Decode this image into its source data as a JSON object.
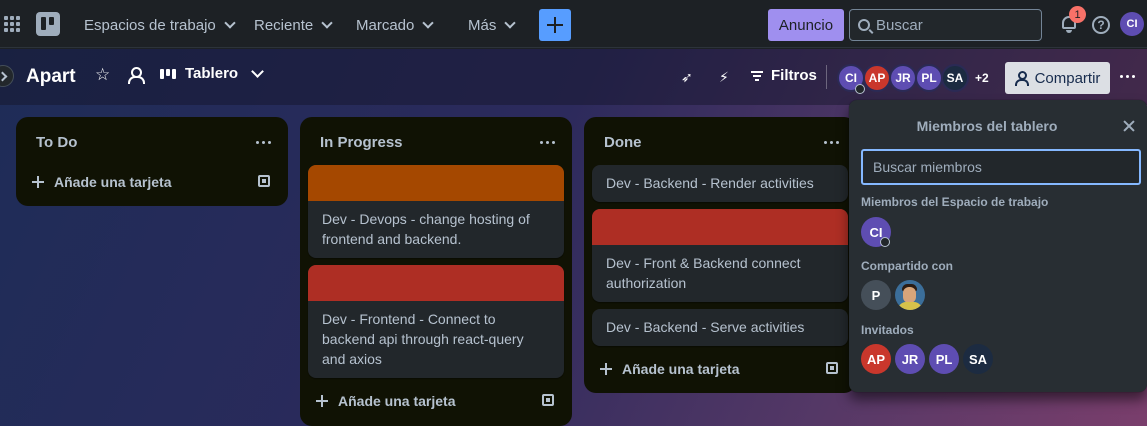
{
  "nav": {
    "workspaces": "Espacios de trabajo",
    "recent": "Reciente",
    "starred": "Marcado",
    "more": "Más",
    "announcement": "Anuncio",
    "search_placeholder": "Buscar",
    "notification_count": "1",
    "help": "?",
    "user_initials": "CI"
  },
  "board": {
    "title": "Apart",
    "view": "Tablero",
    "filters": "Filtros",
    "share": "Compartir",
    "extra_members": "+2",
    "members": [
      {
        "initials": "CI",
        "color": "#5e4db2"
      },
      {
        "initials": "AP",
        "color": "#c9372c"
      },
      {
        "initials": "JR",
        "color": "#5e4db2"
      },
      {
        "initials": "PL",
        "color": "#5e4db2"
      },
      {
        "initials": "SA",
        "color": "#1c2b41"
      }
    ]
  },
  "lists": [
    {
      "title": "To Do",
      "add_card": "Añade una tarjeta",
      "cards": []
    },
    {
      "title": "In Progress",
      "add_card": "Añade una tarjeta",
      "cards": [
        {
          "text": "Dev - Devops - change hosting of frontend and backend.",
          "cover": "#a54800"
        },
        {
          "text": "Dev - Frontend - Connect to backend api through react-query and axios",
          "cover": "#ae2e24"
        }
      ]
    },
    {
      "title": "Done",
      "add_card": "Añade una tarjeta",
      "cards": [
        {
          "text": "Dev - Backend - Render activities",
          "cover": null
        },
        {
          "text": "Dev - Front & Backend connect authorization",
          "cover": "#ae2e24"
        },
        {
          "text": "Dev - Backend - Serve activities",
          "cover": null
        }
      ]
    }
  ],
  "members_popover": {
    "title": "Miembros del tablero",
    "search_placeholder": "Buscar miembros",
    "workspace_members_label": "Miembros del Espacio de trabajo",
    "workspace_members": [
      {
        "initials": "CI",
        "color": "#5e4db2"
      }
    ],
    "shared_with_label": "Compartido con",
    "shared_with": [
      {
        "initials": "P",
        "color": "#454f59"
      }
    ],
    "invited_label": "Invitados",
    "invited": [
      {
        "initials": "AP",
        "color": "#c9372c"
      },
      {
        "initials": "JR",
        "color": "#5e4db2"
      },
      {
        "initials": "PL",
        "color": "#5e4db2"
      },
      {
        "initials": "SA",
        "color": "#1c2b41"
      }
    ]
  }
}
